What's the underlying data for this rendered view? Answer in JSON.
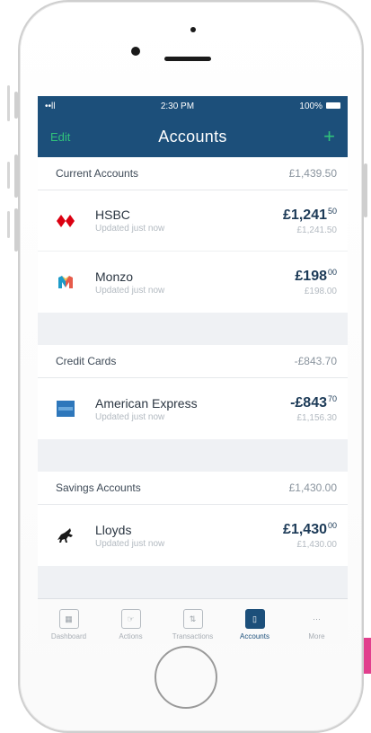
{
  "status_bar": {
    "signal": "••ll",
    "time": "2:30 PM",
    "battery": "100%"
  },
  "nav": {
    "edit": "Edit",
    "title": "Accounts",
    "add": "+"
  },
  "sections": [
    {
      "title": "Current Accounts",
      "total": "£1,439.50",
      "accounts": [
        {
          "name": "HSBC",
          "updated": "Updated just now",
          "amount_main": "£1,241",
          "amount_pence": "50",
          "amount_small": "£1,241.50",
          "icon": "hsbc-icon"
        },
        {
          "name": "Monzo",
          "updated": "Updated just now",
          "amount_main": "£198",
          "amount_pence": "00",
          "amount_small": "£198.00",
          "icon": "monzo-icon"
        }
      ]
    },
    {
      "title": "Credit Cards",
      "total": "-£843.70",
      "accounts": [
        {
          "name": "American Express",
          "updated": "Updated just now",
          "amount_main": "-£843",
          "amount_pence": "70",
          "amount_small": "£1,156.30",
          "icon": "amex-icon"
        }
      ]
    },
    {
      "title": "Savings Accounts",
      "total": "£1,430.00",
      "accounts": [
        {
          "name": "Lloyds",
          "updated": "Updated just now",
          "amount_main": "£1,430",
          "amount_pence": "00",
          "amount_small": "£1,430.00",
          "icon": "lloyds-icon"
        }
      ]
    }
  ],
  "tabs": [
    {
      "label": "Dashboard",
      "icon": "dashboard-icon",
      "active": false
    },
    {
      "label": "Actions",
      "icon": "actions-icon",
      "active": false
    },
    {
      "label": "Transactions",
      "icon": "transactions-icon",
      "active": false
    },
    {
      "label": "Accounts",
      "icon": "accounts-icon",
      "active": true
    },
    {
      "label": "More",
      "icon": "more-icon",
      "active": false
    }
  ],
  "colors": {
    "nav": "#1c4f7a",
    "accent": "#30c27b",
    "amount": "#1c3a57"
  }
}
